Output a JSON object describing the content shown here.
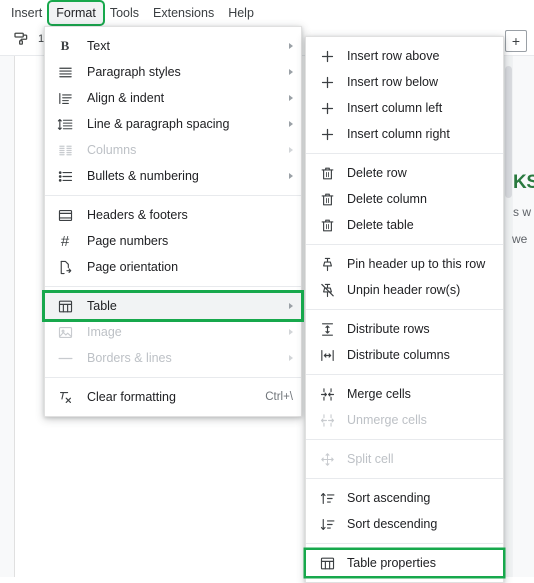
{
  "menubar": {
    "items": [
      {
        "label": "Insert",
        "active": false
      },
      {
        "label": "Format",
        "active": true
      },
      {
        "label": "Tools",
        "active": false
      },
      {
        "label": "Extensions",
        "active": false
      },
      {
        "label": "Help",
        "active": false
      }
    ]
  },
  "toolbar": {
    "paint_format_icon": "paint-roller-icon",
    "zoom_or_count": "1",
    "add_button_label": "+"
  },
  "document": {
    "heading_fragment": "KS",
    "body_fragments": [
      "s w",
      "we"
    ]
  },
  "format_menu": {
    "groups": [
      {
        "items": [
          {
            "label": "Text",
            "icon": "bold-text-icon",
            "arrow": true,
            "disabled": false,
            "shortcut": ""
          },
          {
            "label": "Paragraph styles",
            "icon": "paragraph-styles-icon",
            "arrow": true,
            "disabled": false,
            "shortcut": ""
          },
          {
            "label": "Align & indent",
            "icon": "align-indent-icon",
            "arrow": true,
            "disabled": false,
            "shortcut": ""
          },
          {
            "label": "Line & paragraph spacing",
            "icon": "line-spacing-icon",
            "arrow": true,
            "disabled": false,
            "shortcut": ""
          },
          {
            "label": "Columns",
            "icon": "columns-icon",
            "arrow": true,
            "disabled": true,
            "shortcut": ""
          },
          {
            "label": "Bullets & numbering",
            "icon": "bullets-numbering-icon",
            "arrow": true,
            "disabled": false,
            "shortcut": ""
          }
        ]
      },
      {
        "items": [
          {
            "label": "Headers & footers",
            "icon": "headers-footers-icon",
            "arrow": false,
            "disabled": false,
            "shortcut": ""
          },
          {
            "label": "Page numbers",
            "icon": "page-numbers-icon",
            "arrow": false,
            "disabled": false,
            "shortcut": ""
          },
          {
            "label": "Page orientation",
            "icon": "page-orientation-icon",
            "arrow": false,
            "disabled": false,
            "shortcut": ""
          }
        ]
      },
      {
        "items": [
          {
            "label": "Table",
            "icon": "table-icon",
            "arrow": true,
            "disabled": false,
            "shortcut": "",
            "hovered": true,
            "boxed": true
          },
          {
            "label": "Image",
            "icon": "image-icon",
            "arrow": true,
            "disabled": true,
            "shortcut": ""
          },
          {
            "label": "Borders & lines",
            "icon": "borders-lines-icon",
            "arrow": true,
            "disabled": true,
            "shortcut": ""
          }
        ]
      },
      {
        "items": [
          {
            "label": "Clear formatting",
            "icon": "clear-formatting-icon",
            "arrow": false,
            "disabled": false,
            "shortcut": "Ctrl+\\"
          }
        ]
      }
    ]
  },
  "table_submenu": {
    "groups": [
      {
        "items": [
          {
            "label": "Insert row above",
            "icon": "plus-icon",
            "disabled": false
          },
          {
            "label": "Insert row below",
            "icon": "plus-icon",
            "disabled": false
          },
          {
            "label": "Insert column left",
            "icon": "plus-icon",
            "disabled": false
          },
          {
            "label": "Insert column right",
            "icon": "plus-icon",
            "disabled": false
          }
        ]
      },
      {
        "items": [
          {
            "label": "Delete row",
            "icon": "trash-icon",
            "disabled": false
          },
          {
            "label": "Delete column",
            "icon": "trash-icon",
            "disabled": false
          },
          {
            "label": "Delete table",
            "icon": "trash-icon",
            "disabled": false
          }
        ]
      },
      {
        "items": [
          {
            "label": "Pin header up to this row",
            "icon": "pin-icon",
            "disabled": false
          },
          {
            "label": "Unpin header row(s)",
            "icon": "unpin-icon",
            "disabled": false
          }
        ]
      },
      {
        "items": [
          {
            "label": "Distribute rows",
            "icon": "distribute-rows-icon",
            "disabled": false
          },
          {
            "label": "Distribute columns",
            "icon": "distribute-columns-icon",
            "disabled": false
          }
        ]
      },
      {
        "items": [
          {
            "label": "Merge cells",
            "icon": "merge-cells-icon",
            "disabled": false
          },
          {
            "label": "Unmerge cells",
            "icon": "unmerge-cells-icon",
            "disabled": true
          }
        ]
      },
      {
        "items": [
          {
            "label": "Split cell",
            "icon": "split-cell-icon",
            "disabled": true
          }
        ]
      },
      {
        "items": [
          {
            "label": "Sort ascending",
            "icon": "sort-ascending-icon",
            "disabled": false
          },
          {
            "label": "Sort descending",
            "icon": "sort-descending-icon",
            "disabled": false
          }
        ]
      },
      {
        "items": [
          {
            "label": "Table properties",
            "icon": "table-icon",
            "disabled": false,
            "boxed": true
          }
        ]
      }
    ]
  },
  "colors": {
    "highlight_green": "#17a84c",
    "hover_grey": "#f1f3f4",
    "text": "#202124",
    "disabled_text": "#bdc1c6",
    "doc_heading_green": "#2a7a3f"
  }
}
